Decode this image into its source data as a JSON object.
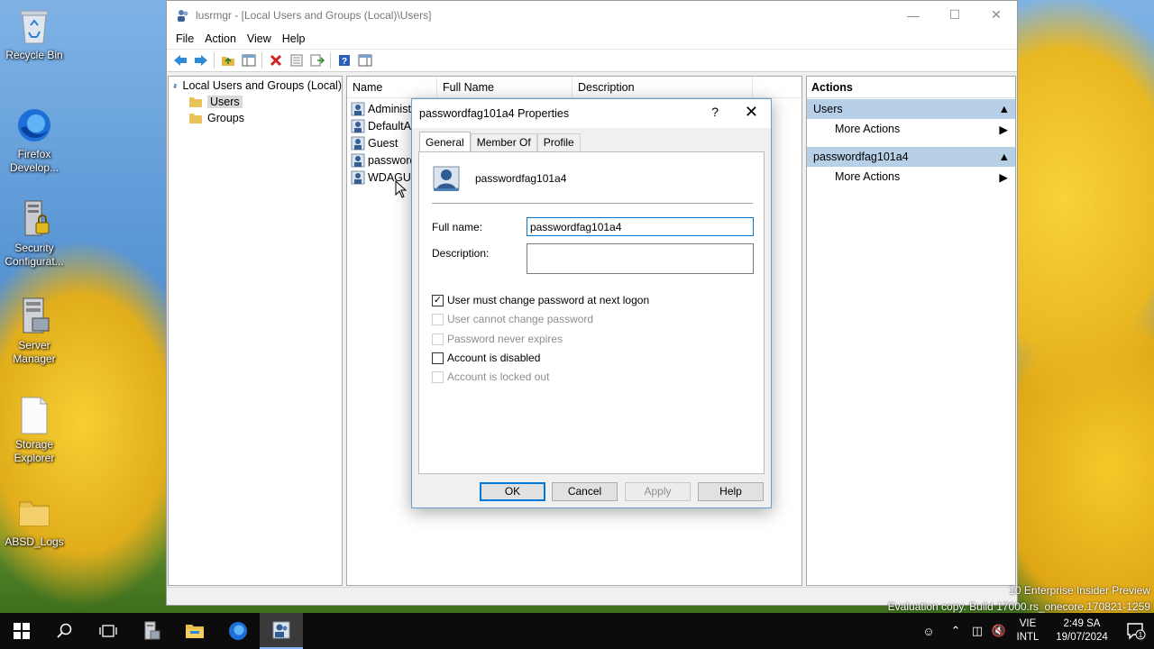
{
  "desktop": {
    "icons": [
      {
        "label": "Recycle Bin",
        "icon": "recycle-bin-icon"
      },
      {
        "label": "Firefox Develop...",
        "icon": "firefox-developer-icon"
      },
      {
        "label": "Security Configurat...",
        "icon": "security-config-icon"
      },
      {
        "label": "Server Manager",
        "icon": "server-manager-icon"
      },
      {
        "label": "Storage Explorer",
        "icon": "storage-explorer-icon"
      },
      {
        "label": "ABSD_Logs",
        "icon": "folder-icon"
      }
    ]
  },
  "window": {
    "title": "lusrmgr - [Local Users and Groups (Local)\\Users]",
    "menu": [
      "File",
      "Action",
      "View",
      "Help"
    ],
    "tree": {
      "root": "Local Users and Groups (Local)",
      "children": [
        "Users",
        "Groups"
      ]
    },
    "list": {
      "columns": [
        "Name",
        "Full Name",
        "Description"
      ],
      "rows": [
        "Administ",
        "DefaultAc",
        "Guest",
        "password",
        "WDAGUti"
      ]
    },
    "actions": {
      "title": "Actions",
      "sections": [
        {
          "label": "Users",
          "item": "More Actions"
        },
        {
          "label": "passwordfag101a4",
          "item": "More Actions"
        }
      ]
    }
  },
  "dialog": {
    "title": "passwordfag101a4 Properties",
    "help_glyph": "?",
    "tabs": [
      "General",
      "Member Of",
      "Profile"
    ],
    "username": "passwordfag101a4",
    "full_name_label": "Full name:",
    "full_name_value": "passwordfag101a4",
    "description_label": "Description:",
    "description_value": "",
    "checkboxes": [
      {
        "label": "User must change password at next logon",
        "checked": true,
        "enabled": true
      },
      {
        "label": "User cannot change password",
        "checked": false,
        "enabled": false
      },
      {
        "label": "Password never expires",
        "checked": false,
        "enabled": false
      },
      {
        "label": "Account is disabled",
        "checked": false,
        "enabled": true
      },
      {
        "label": "Account is locked out",
        "checked": false,
        "enabled": false
      }
    ],
    "buttons": {
      "ok": "OK",
      "cancel": "Cancel",
      "apply": "Apply",
      "help": "Help"
    }
  },
  "watermark": {
    "line1": "10 Enterprise Insider Preview",
    "line2": "Evaluation copy. Build 17000.rs_onecore.170821-1259"
  },
  "taskbar": {
    "lang_top": "VIE",
    "lang_bottom": "INTL",
    "time": "2:49 SA",
    "date": "19/07/2024",
    "notification_count": "1"
  },
  "colors": {
    "accent": "#0078d7",
    "action_section": "#b7cfe7",
    "taskbar": "#0c0c0c"
  }
}
